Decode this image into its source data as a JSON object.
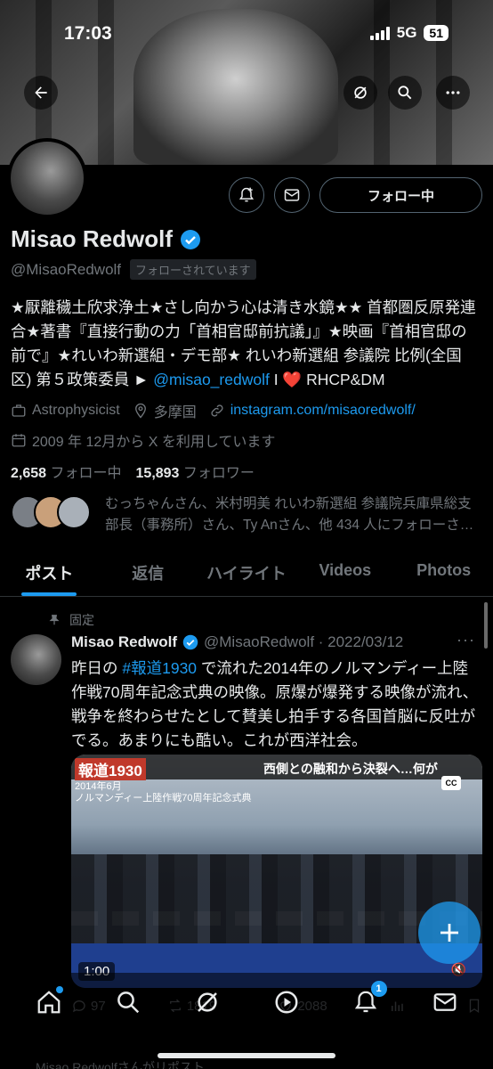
{
  "status": {
    "time": "17:03",
    "network": "5G",
    "battery": "51"
  },
  "profile": {
    "name": "Misao Redwolf",
    "handle": "@MisaoRedwolf",
    "follows_you": "フォローされています",
    "follow_button": "フォロー中",
    "bio_main": "★厭離穢土欣求浄土★さし向かう心は清き水鏡★★ 首都圏反原発連合★著書『直接行動の力「首相官邸前抗議」』★映画『首相官邸の前で』★れいわ新選組・デモ部★ れいわ新選組 参議院 比例(全国区) 第５政策委員 ► ",
    "bio_link": "@misao_redwolf",
    "bio_sep": " I ",
    "bio_heart": "❤️",
    "bio_tail": " RHCP&DM",
    "category": "Astrophysicist",
    "location": "多摩国",
    "website": "instagram.com/misaoredwolf/",
    "joined": "2009 年 12月から X を利用しています",
    "following_count": "2,658",
    "following_label": "フォロー中",
    "followers_count": "15,893",
    "followers_label": "フォロワー",
    "followed_by": "むっちゃんさん、米村明美 れいわ新選組 参議院兵庫県総支部長（事務所）さん、Ty Anさん、他 434 人にフォローさ…"
  },
  "tabs": [
    {
      "label": "ポスト",
      "active": true
    },
    {
      "label": "返信",
      "active": false
    },
    {
      "label": "ハイライト",
      "active": false
    },
    {
      "label": "Videos",
      "active": false
    },
    {
      "label": "Photos",
      "active": false
    }
  ],
  "tweet": {
    "pinned_label": "固定",
    "name": "Misao Redwolf",
    "meta": "@MisaoRedwolf · 2022/03/12",
    "text_before": "昨日の ",
    "hashtag": "#報道1930",
    "text_after": " で流れた2014年のノルマンディー上陸作戦70周年記念式典の映像。原爆が爆発する映像が流れ、戦争を終わらせたとして賛美し拍手する各国首脳に反吐がでる。あまりにも酷い。これが西洋社会。",
    "video": {
      "channel": "報道1930",
      "caption": "西側との融和から決裂へ…何が",
      "subtitle_1": "2014年6月",
      "subtitle_2": "ノルマンディー上陸作戦70周年記念式典",
      "cc": "CC",
      "duration": "1:00"
    },
    "replies": "97",
    "reposts": "1819",
    "likes": "2088"
  },
  "nav": {
    "notification_badge": "1"
  },
  "peek_text": "Misao Redwolfさんがリポスト"
}
